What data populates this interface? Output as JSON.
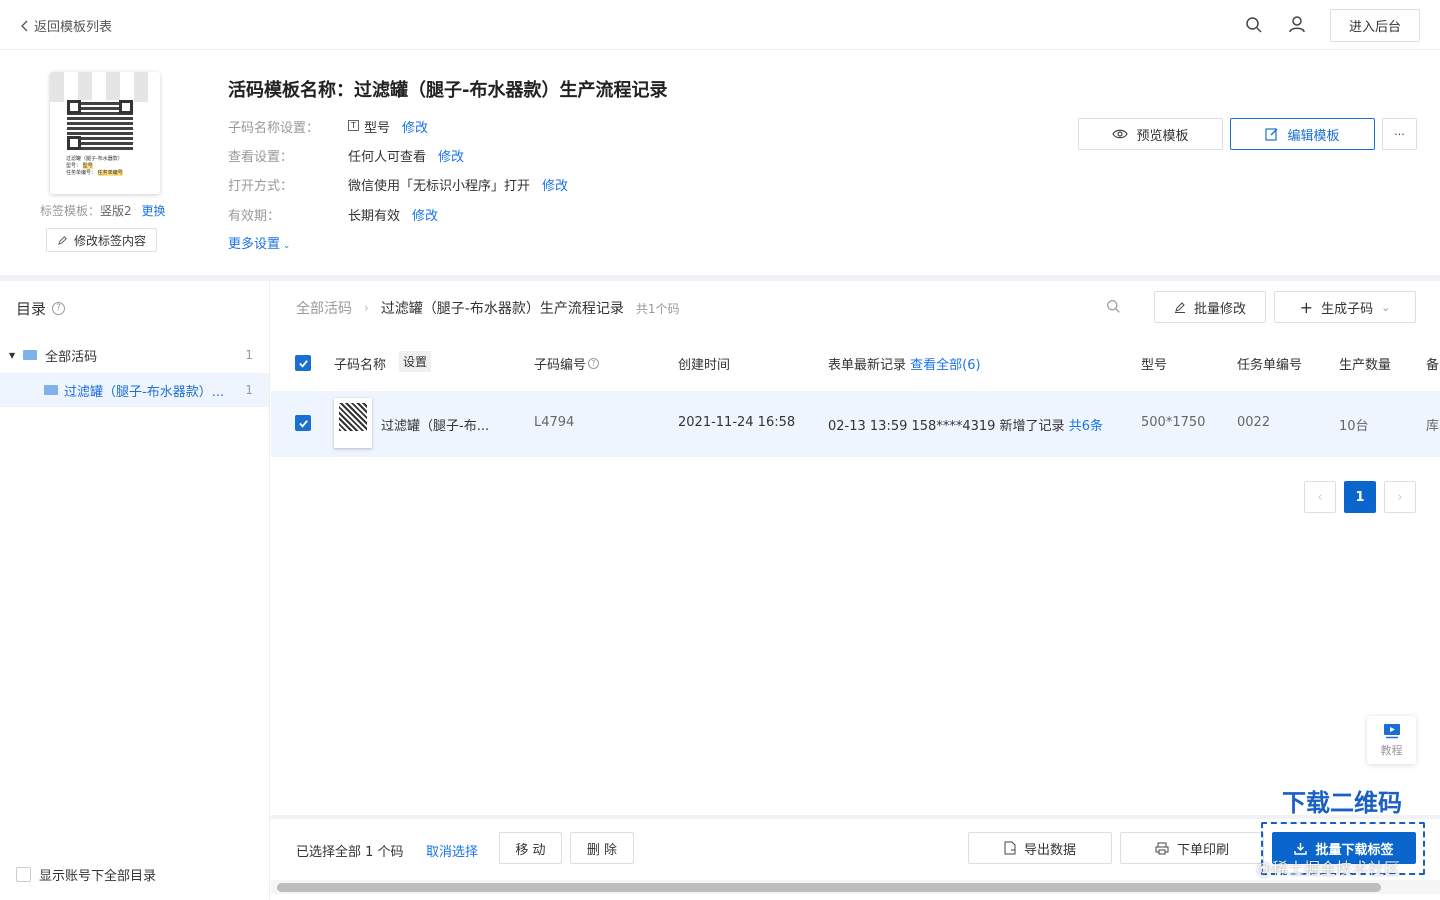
{
  "top": {
    "back_label": "返回模板列表",
    "enter_backend": "进入后台"
  },
  "template": {
    "title": "活码模板名称：过滤罐（腿子-布水器款）生产流程记录",
    "label_template_prefix": "标签模板：",
    "label_template_value": "竖版2",
    "label_template_change": "更换",
    "edit_label_content": "修改标签内容",
    "thumb_lines": [
      "过滤罐（腿子-布水器款）",
      "型号：",
      "型号",
      "任务单编号：",
      "任务单编号"
    ],
    "settings": [
      {
        "label": "子码名称设置：",
        "value": "型号",
        "action": "修改"
      },
      {
        "label": "查看设置：",
        "value": "任何人可查看",
        "action": "修改"
      },
      {
        "label": "打开方式：",
        "value": "微信使用「无标识小程序」打开",
        "action": "修改"
      },
      {
        "label": "有效期：",
        "value": "长期有效",
        "action": "修改"
      }
    ],
    "more_settings": "更多设置",
    "preview_btn": "预览模板",
    "edit_btn": "编辑模板",
    "more_btn": "···"
  },
  "sidebar": {
    "title": "目录",
    "items": [
      {
        "label": "全部活码",
        "count": "1"
      },
      {
        "label": "过滤罐（腿子-布水器款）...",
        "count": "1"
      }
    ],
    "show_all_label": "显示账号下全部目录"
  },
  "main": {
    "breadcrumb_root": "全部活码",
    "breadcrumb_current": "过滤罐（腿子-布水器款）生产流程记录",
    "count_text": "共1个码",
    "batch_edit": "批量修改",
    "generate_sub": "生成子码",
    "columns": {
      "name": "子码名称",
      "settings": "设置",
      "number": "子码编号",
      "created": "创建时间",
      "latest_record": "表单最新记录",
      "view_all": "查看全部(6)",
      "model": "型号",
      "task_no": "任务单编号",
      "quantity": "生产数量",
      "remark": "备"
    },
    "rows": [
      {
        "name": "过滤罐（腿子-布...",
        "number": "L4794",
        "created": "2021-11-24 16:58",
        "latest": "02-13 13:59 158****4319 新增了记录",
        "latest_count": "共6条",
        "model": "500*1750",
        "task_no": "0022",
        "quantity": "10台",
        "remark": "库"
      }
    ],
    "pagination": {
      "current": "1"
    }
  },
  "tutorial": {
    "label": "教程"
  },
  "bottom": {
    "selected_text": "已选择全部 1 个码",
    "cancel_select": "取消选择",
    "move": "移 动",
    "delete": "删 除",
    "export": "导出数据",
    "print": "下单印刷",
    "batch_download": "批量下载标签"
  },
  "annotation": {
    "text": "下载二维码",
    "watermark": "@稀土掘金技术社区"
  },
  "colors": {
    "primary": "#1a6fd3",
    "selected_row": "#eef5ff",
    "annotation": "#1a5fc4"
  }
}
